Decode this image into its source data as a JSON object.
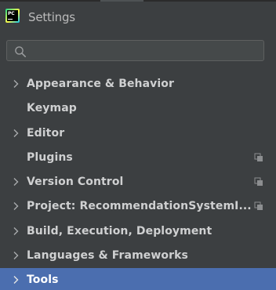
{
  "window": {
    "title": "Settings",
    "app_icon": "pycharm-logo",
    "app_icon_text": "PC"
  },
  "search": {
    "value": "",
    "placeholder": "",
    "icon": "search-icon"
  },
  "tree": {
    "items": [
      {
        "label": "Appearance & Behavior",
        "expandable": true,
        "project_scoped": false,
        "selected": false
      },
      {
        "label": "Keymap",
        "expandable": false,
        "project_scoped": false,
        "selected": false
      },
      {
        "label": "Editor",
        "expandable": true,
        "project_scoped": false,
        "selected": false
      },
      {
        "label": "Plugins",
        "expandable": false,
        "project_scoped": true,
        "selected": false
      },
      {
        "label": "Version Control",
        "expandable": true,
        "project_scoped": true,
        "selected": false
      },
      {
        "label": "Project: RecommendationSystemI...",
        "expandable": true,
        "project_scoped": true,
        "selected": false
      },
      {
        "label": "Build, Execution, Deployment",
        "expandable": true,
        "project_scoped": false,
        "selected": false
      },
      {
        "label": "Languages & Frameworks",
        "expandable": true,
        "project_scoped": false,
        "selected": false
      },
      {
        "label": "Tools",
        "expandable": true,
        "project_scoped": false,
        "selected": true
      }
    ]
  },
  "colors": {
    "background": "#3c3f41",
    "selection": "#4b6eaf",
    "text": "#cfd0d1",
    "icon": "#8c8e90"
  }
}
